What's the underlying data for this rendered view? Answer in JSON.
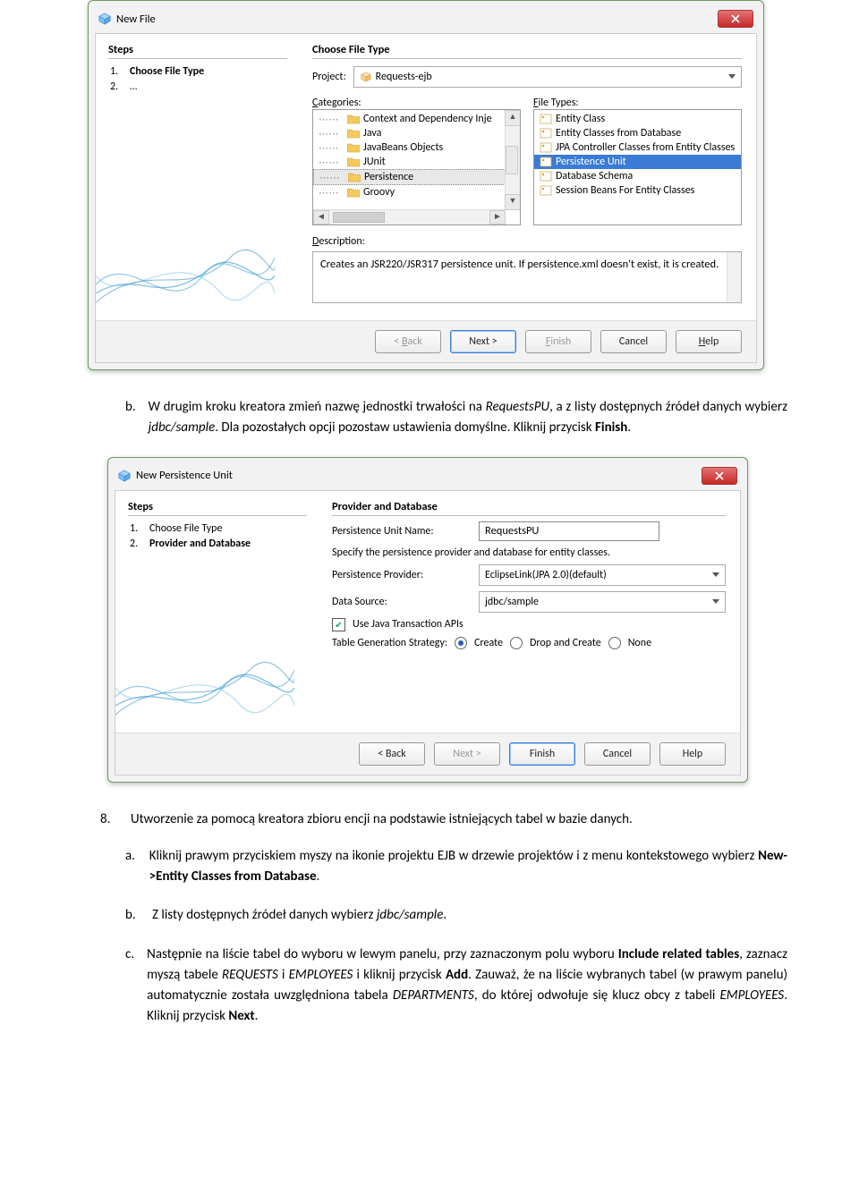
{
  "dialog1": {
    "title": "New File",
    "steps_title": "Steps",
    "steps": [
      {
        "num": "1.",
        "label": "Choose File Type",
        "bold": true
      },
      {
        "num": "2.",
        "label": "…",
        "bold": false
      }
    ],
    "right_title": "Choose File Type",
    "project_label": "Project:",
    "project_value": "Requests-ejb",
    "categories_label": "Categories:",
    "filetypes_label": "File Types:",
    "categories": [
      "Context and Dependency Inje",
      "Java",
      "JavaBeans Objects",
      "JUnit",
      "Persistence",
      "Groovy"
    ],
    "categories_selected_index": 4,
    "filetypes": [
      "Entity Class",
      "Entity Classes from Database",
      "JPA Controller Classes from Entity Classes",
      "Persistence Unit",
      "Database Schema",
      "Session Beans For Entity Classes"
    ],
    "filetypes_selected_index": 3,
    "description_label": "Description:",
    "description_text": "Creates an JSR220/JSR317 persistence unit. If persistence.xml doesn't exist, it is created.",
    "buttons": {
      "back": "< Back",
      "next": "Next >",
      "finish": "Finish",
      "cancel": "Cancel",
      "help": "Help"
    }
  },
  "para_b": {
    "letter": "b.",
    "text_1": "W drugim kroku kreatora zmień nazwę jednostki trwałości na ",
    "em_1": "RequestsPU",
    "text_2": ", a z listy dostępnych źródeł danych wybierz ",
    "em_2": "jdbc/sample",
    "text_3": ". Dla pozostałych opcji pozostaw ustawienia domyślne. Kliknij przycisk ",
    "strong_1": "Finish",
    "text_4": "."
  },
  "dialog2": {
    "title": "New Persistence Unit",
    "steps_title": "Steps",
    "steps": [
      {
        "num": "1.",
        "label": "Choose File Type",
        "bold": false
      },
      {
        "num": "2.",
        "label": "Provider and Database",
        "bold": true
      }
    ],
    "right_title": "Provider and Database",
    "pu_name_label": "Persistence Unit Name:",
    "pu_name_value": "RequestsPU",
    "specify_text": "Specify the persistence provider and database for entity classes.",
    "provider_label": "Persistence Provider:",
    "provider_value": "EclipseLink(JPA 2.0)(default)",
    "datasource_label": "Data Source:",
    "datasource_value": "jdbc/sample",
    "use_jta_label": "Use Java Transaction APIs",
    "strategy_label": "Table Generation Strategy:",
    "strategy_opts": [
      "Create",
      "Drop and Create",
      "None"
    ],
    "strategy_selected": 0,
    "buttons": {
      "back": "< Back",
      "next": "Next >",
      "finish": "Finish",
      "cancel": "Cancel",
      "help": "Help"
    }
  },
  "step8": {
    "num": "8.",
    "text": "Utworzenie za pomocą kreatora zbioru encji na podstawie istniejących tabel w bazie danych."
  },
  "para_a2": {
    "letter": "a.",
    "text_1": "Kliknij prawym przyciskiem myszy na ikonie projektu EJB w drzewie projektów i z menu kontekstowego wybierz ",
    "strong_1": "New->Entity Classes from Database",
    "text_2": "."
  },
  "para_b2": {
    "letter": "b.",
    "text_1": "Z listy dostępnych źródeł danych wybierz ",
    "em_1": "jdbc/sample",
    "text_2": "."
  },
  "para_c2": {
    "letter": "c.",
    "t1": "Następnie na liście tabel do wyboru w lewym panelu, przy zaznaczonym polu wyboru ",
    "s1": "Include related tables",
    "t2": ", zaznacz myszą tabele ",
    "e1": "REQUESTS",
    "t3": " i ",
    "e2": "EMPLOYEES",
    "t4": " i kliknij przycisk ",
    "s2": "Add",
    "t5": ". Zauważ, że na liście wybranych tabel (w prawym panelu) automatycznie została uwzględniona tabela ",
    "e3": "DEPARTMENTS",
    "t6": ", do której odwołuje się klucz obcy z tabeli ",
    "e4": "EMPLOYEES",
    "t7": ". Kliknij przycisk ",
    "s3": "Next",
    "t8": "."
  }
}
